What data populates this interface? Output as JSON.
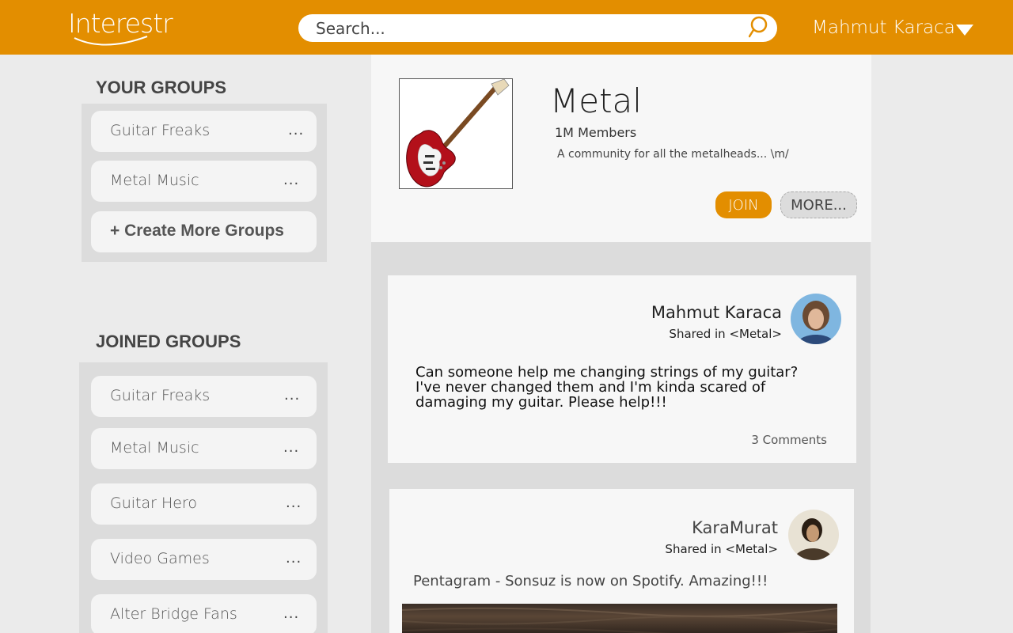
{
  "app": {
    "logo_text": "Interestr",
    "brand_color": "#e38e00"
  },
  "search": {
    "placeholder": "Search..."
  },
  "user": {
    "name": "Mahmut Karaca"
  },
  "your_groups": {
    "title": "YOUR GROUPS",
    "items": [
      {
        "label": "Guitar Freaks",
        "more": "..."
      },
      {
        "label": "Metal Music",
        "more": "..."
      }
    ],
    "create_label": "+ Create More Groups"
  },
  "joined_groups": {
    "title": "JOINED GROUPS",
    "items": [
      {
        "label": "Guitar Freaks",
        "more": "..."
      },
      {
        "label": "Metal Music",
        "more": "..."
      },
      {
        "label": "Guitar Hero",
        "more": "..."
      },
      {
        "label": "Video Games",
        "more": "..."
      },
      {
        "label": "Alter Bridge Fans",
        "more": "..."
      }
    ]
  },
  "group": {
    "name": "Metal",
    "members": "1M Members",
    "description": "A community for all the metalheads... \\m/",
    "join_label": "JOIN",
    "more_label": "MORE..."
  },
  "posts": [
    {
      "author": "Mahmut Karaca",
      "shared_in": "Shared in <Metal>",
      "body": "Can someone help me changing strings of my guitar? I've never changed them and I'm kinda scared of damaging my guitar. Please help!!!",
      "comments": "3 Comments"
    },
    {
      "author": "KaraMurat",
      "shared_in": "Shared in <Metal>",
      "body": "Pentagram - Sonsuz is now on Spotify. Amazing!!!"
    }
  ]
}
